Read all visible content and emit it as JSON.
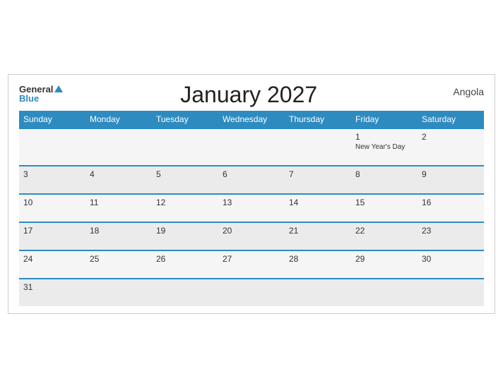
{
  "header": {
    "logo_general": "General",
    "logo_blue": "Blue",
    "title": "January 2027",
    "country": "Angola"
  },
  "days_of_week": [
    "Sunday",
    "Monday",
    "Tuesday",
    "Wednesday",
    "Thursday",
    "Friday",
    "Saturday"
  ],
  "weeks": [
    [
      {
        "day": "",
        "event": ""
      },
      {
        "day": "",
        "event": ""
      },
      {
        "day": "",
        "event": ""
      },
      {
        "day": "",
        "event": ""
      },
      {
        "day": "",
        "event": ""
      },
      {
        "day": "1",
        "event": "New Year's Day"
      },
      {
        "day": "2",
        "event": ""
      }
    ],
    [
      {
        "day": "3",
        "event": ""
      },
      {
        "day": "4",
        "event": ""
      },
      {
        "day": "5",
        "event": ""
      },
      {
        "day": "6",
        "event": ""
      },
      {
        "day": "7",
        "event": ""
      },
      {
        "day": "8",
        "event": ""
      },
      {
        "day": "9",
        "event": ""
      }
    ],
    [
      {
        "day": "10",
        "event": ""
      },
      {
        "day": "11",
        "event": ""
      },
      {
        "day": "12",
        "event": ""
      },
      {
        "day": "13",
        "event": ""
      },
      {
        "day": "14",
        "event": ""
      },
      {
        "day": "15",
        "event": ""
      },
      {
        "day": "16",
        "event": ""
      }
    ],
    [
      {
        "day": "17",
        "event": ""
      },
      {
        "day": "18",
        "event": ""
      },
      {
        "day": "19",
        "event": ""
      },
      {
        "day": "20",
        "event": ""
      },
      {
        "day": "21",
        "event": ""
      },
      {
        "day": "22",
        "event": ""
      },
      {
        "day": "23",
        "event": ""
      }
    ],
    [
      {
        "day": "24",
        "event": ""
      },
      {
        "day": "25",
        "event": ""
      },
      {
        "day": "26",
        "event": ""
      },
      {
        "day": "27",
        "event": ""
      },
      {
        "day": "28",
        "event": ""
      },
      {
        "day": "29",
        "event": ""
      },
      {
        "day": "30",
        "event": ""
      }
    ],
    [
      {
        "day": "31",
        "event": ""
      },
      {
        "day": "",
        "event": ""
      },
      {
        "day": "",
        "event": ""
      },
      {
        "day": "",
        "event": ""
      },
      {
        "day": "",
        "event": ""
      },
      {
        "day": "",
        "event": ""
      },
      {
        "day": "",
        "event": ""
      }
    ]
  ]
}
